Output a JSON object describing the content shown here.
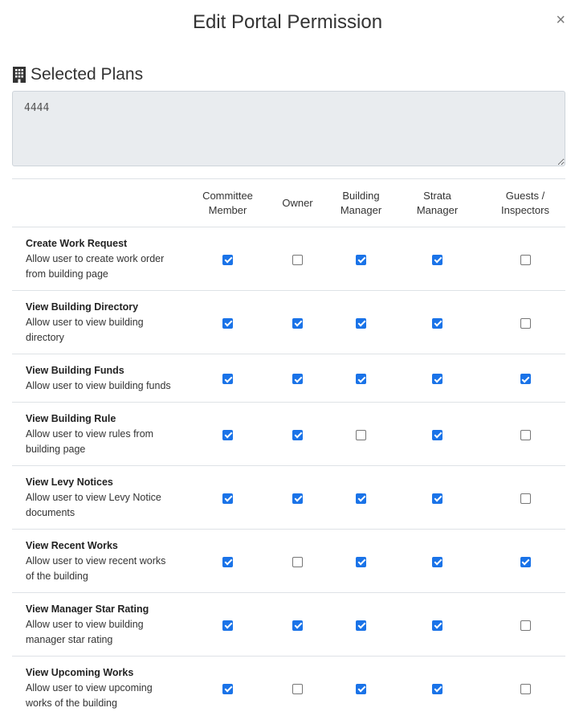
{
  "modal": {
    "title": "Edit Portal Permission",
    "close_label": "×"
  },
  "selected_plans": {
    "heading": "Selected Plans",
    "icon": "building-icon",
    "value": "4444"
  },
  "columns": [
    {
      "line1": "Committee",
      "line2": "Member"
    },
    {
      "line1": "Owner",
      "line2": ""
    },
    {
      "line1": "Building",
      "line2": "Manager"
    },
    {
      "line1": "Strata",
      "line2": "Manager"
    },
    {
      "line1": "Guests /",
      "line2": "Inspectors"
    }
  ],
  "permissions": [
    {
      "name": "Create Work Request",
      "desc1": "Allow user to create work order",
      "desc2": "from building page",
      "checks": [
        true,
        false,
        true,
        true,
        false
      ]
    },
    {
      "name": "View Building Directory",
      "desc1": "Allow user to view building",
      "desc2": "directory",
      "checks": [
        true,
        true,
        true,
        true,
        false
      ]
    },
    {
      "name": "View Building Funds",
      "desc1": "Allow user to view building funds",
      "desc2": "",
      "checks": [
        true,
        true,
        true,
        true,
        true
      ]
    },
    {
      "name": "View Building Rule",
      "desc1": "Allow user to view rules from",
      "desc2": "building page",
      "checks": [
        true,
        true,
        false,
        true,
        false
      ]
    },
    {
      "name": "View Levy Notices",
      "desc1": "Allow user to view Levy Notice",
      "desc2": "documents",
      "checks": [
        true,
        true,
        true,
        true,
        false
      ]
    },
    {
      "name": "View Recent Works",
      "desc1": "Allow user to view recent works",
      "desc2": "of the building",
      "checks": [
        true,
        false,
        true,
        true,
        true
      ]
    },
    {
      "name": "View Manager Star Rating",
      "desc1": "Allow user to view building",
      "desc2": "manager star rating",
      "checks": [
        true,
        true,
        true,
        true,
        false
      ]
    },
    {
      "name": "View Upcoming Works",
      "desc1": "Allow user to view upcoming",
      "desc2": "works of the building",
      "checks": [
        true,
        false,
        true,
        true,
        false
      ]
    }
  ],
  "colors": {
    "checkbox_checked": "#1a73e8",
    "plans_box_bg": "#e9ecef",
    "divider": "#dee2e6"
  }
}
